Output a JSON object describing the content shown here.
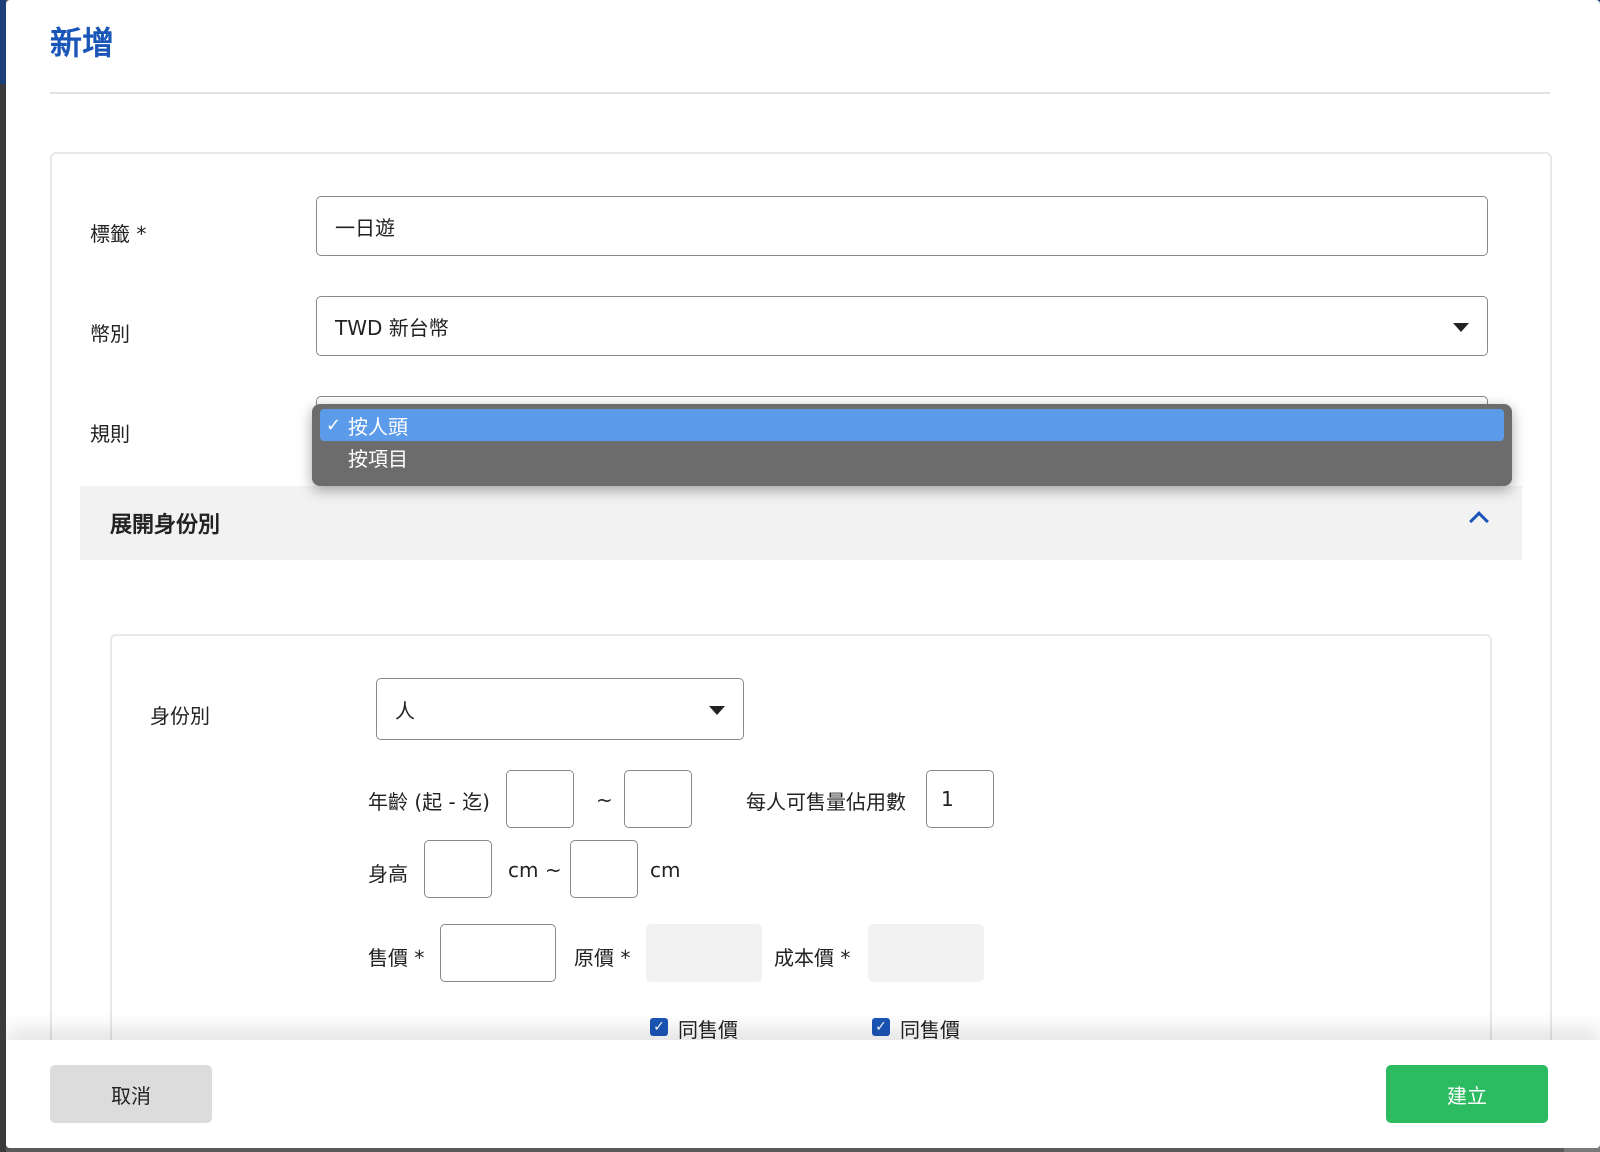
{
  "modal": {
    "title": "新增"
  },
  "form": {
    "tag": {
      "label": "標籤 *",
      "value": "一日遊"
    },
    "currency": {
      "label": "幣別",
      "value": "TWD 新台幣"
    },
    "rule": {
      "label": "規則",
      "options": [
        {
          "label": "按人頭",
          "selected": true,
          "check": "✓"
        },
        {
          "label": "按項目",
          "selected": false,
          "check": ""
        }
      ]
    }
  },
  "section": {
    "title": "展開身份別",
    "expanded": true
  },
  "identity": {
    "label": "身份別",
    "value": "人",
    "age_label": "年齡 (起 - 迄)",
    "age_from": "",
    "age_sep": "~",
    "age_to": "",
    "occupancy_label": "每人可售量佔用數",
    "occupancy_value": "1",
    "height_label": "身高",
    "height_from": "",
    "height_unit_sep": "cm ~",
    "height_to": "",
    "height_unit": "cm",
    "sale_price_label": "售價 *",
    "sale_price": "",
    "original_price_label": "原價 *",
    "original_price": "",
    "cost_price_label": "成本價 *",
    "cost_price": "",
    "same_as_sale_1": "同售價",
    "same_as_sale_2": "同售價",
    "check_glyph": "✓"
  },
  "footer": {
    "cancel_label": "取消",
    "create_label": "建立"
  },
  "colors": {
    "accent": "#1a56b8",
    "create": "#2dbb62",
    "dropdown_highlight": "#5b9bea"
  }
}
